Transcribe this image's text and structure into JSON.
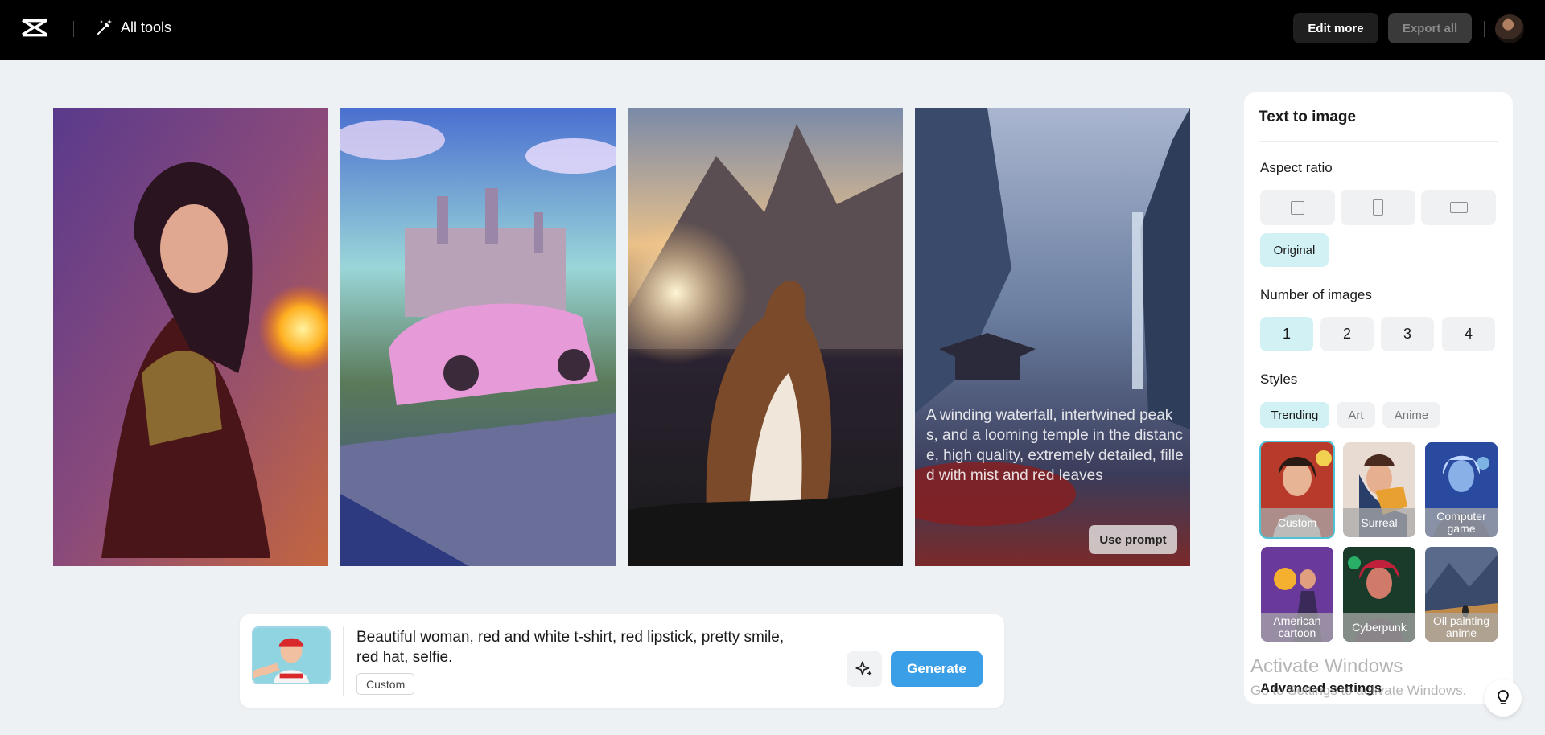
{
  "header": {
    "logo_icon": "capcut-logo-icon",
    "all_tools_label": "All tools",
    "all_tools_icon": "magic-wand-icon",
    "edit_more_label": "Edit more",
    "export_all_label": "Export all"
  },
  "gallery": {
    "images": [
      {
        "subject": "fantasy woman with fireball"
      },
      {
        "subject": "pink car before castle"
      },
      {
        "subject": "cat on rock before mountain"
      },
      {
        "subject": "waterfall with temple"
      }
    ],
    "hover_prompt": "A winding waterfall, intertwined peaks, and a looming temple in the distance, high quality, extremely detailed, filled with mist and red leaves",
    "use_prompt_label": "Use prompt"
  },
  "prompt_bar": {
    "text": "Beautiful woman, red and white t-shirt, red lipstick, pretty smile, red hat, selfie.",
    "style_tag": "Custom",
    "magic_icon": "sparkle-icon",
    "generate_label": "Generate"
  },
  "panel": {
    "title": "Text to image",
    "aspect_ratio_label": "Aspect ratio",
    "aspect_original_label": "Original",
    "num_images_label": "Number of images",
    "num_options": [
      "1",
      "2",
      "3",
      "4"
    ],
    "num_selected": "1",
    "styles_label": "Styles",
    "style_tabs": [
      "Trending",
      "Art",
      "Anime"
    ],
    "style_tab_selected": "Trending",
    "styles": [
      "Custom",
      "Surreal",
      "Computer game",
      "American cartoon",
      "Cyberpunk",
      "Oil painting anime"
    ],
    "style_selected": "Custom",
    "advanced_label": "Advanced settings"
  },
  "watermark": {
    "line1": "Activate Windows",
    "line2": "Go to Settings to activate Windows."
  },
  "colors": {
    "accent": "#3b9fe8",
    "selected_bg": "#d2f1f5",
    "topbar": "#000000"
  }
}
